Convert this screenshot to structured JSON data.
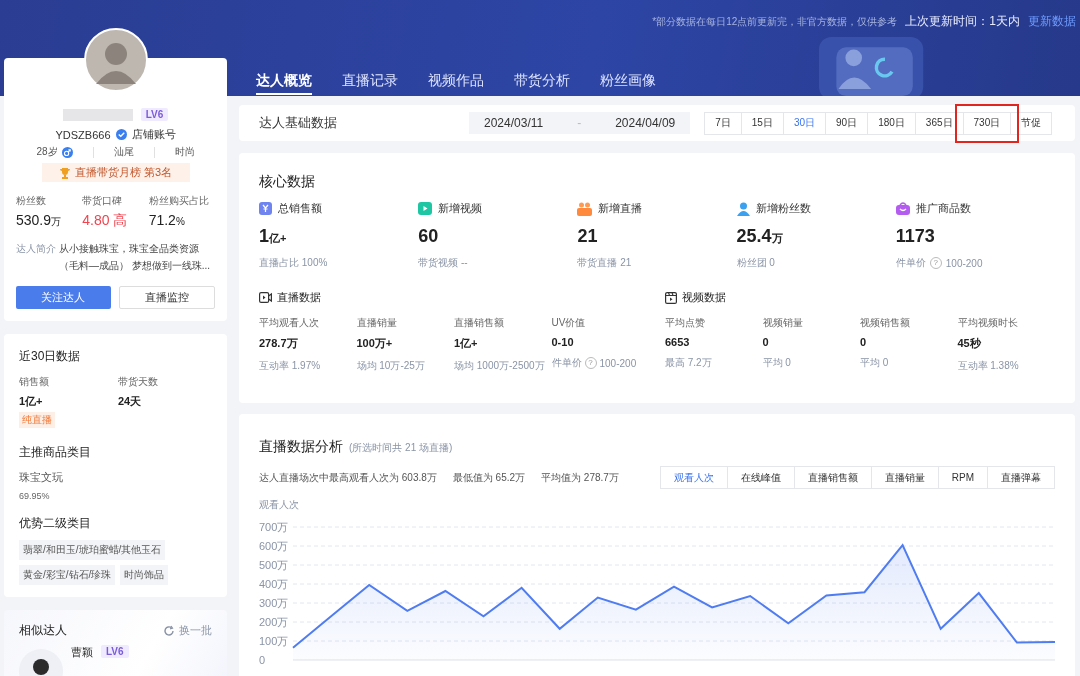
{
  "notice": {
    "text": "*部分数据在每日12点前更新完，非官方数据，仅供参考",
    "update_label": "上次更新时间：1天内",
    "update_link": "更新数据"
  },
  "profile": {
    "level": "LV6",
    "account": "YDSZB666",
    "account_type": "店铺账号",
    "age": "28岁",
    "region": "汕尾",
    "category": "时尚",
    "rank": "直播带货月榜 第3名",
    "stats": [
      {
        "label": "粉丝数",
        "value": "530.9",
        "unit": "万",
        "kind": "normal"
      },
      {
        "label": "带货口碑",
        "value": "4.80 高",
        "kind": "alert"
      },
      {
        "label": "粉丝购买占比",
        "value": "71.2",
        "unit": "%",
        "kind": "normal"
      }
    ],
    "intro_label": "达人简介",
    "intro": "从小接触珠宝，珠宝全品类资源（毛料—成品） 梦想做到一线珠...",
    "buttons": [
      {
        "label": "关注达人",
        "kind": "primary"
      },
      {
        "label": "直播监控",
        "kind": "secondary"
      }
    ]
  },
  "recent": {
    "title": "近30日数据",
    "stats": [
      {
        "label": "销售额",
        "value": "1亿+"
      },
      {
        "label": "带货天数",
        "value": "24天"
      }
    ],
    "tag": "纯直播",
    "main_title": "主推商品类目",
    "main_category": "珠宝文玩",
    "main_share": "69.95%",
    "sub_title": "优势二级类目",
    "sub_tags": [
      "翡翠/和田玉/琥珀蜜蜡/其他玉石",
      "黄金/彩宝/钻石/珍珠",
      "时尚饰品"
    ]
  },
  "similar": {
    "title": "相似达人",
    "refresh": "换一批",
    "items": [
      {
        "name": "曹颖",
        "level": "LV6"
      }
    ]
  },
  "tabs": [
    {
      "label": "达人概览",
      "selected": true
    },
    {
      "label": "直播记录",
      "selected": false
    },
    {
      "label": "视频作品",
      "selected": false
    },
    {
      "label": "带货分析",
      "selected": false
    },
    {
      "label": "粉丝画像",
      "selected": false
    }
  ],
  "filter": {
    "title": "达人基础数据",
    "start": "2024/03/11",
    "separator": "-",
    "end": "2024/04/09",
    "periods": [
      {
        "label": "7日",
        "selected": false,
        "annotated": false
      },
      {
        "label": "15日",
        "selected": false,
        "annotated": false
      },
      {
        "label": "30日",
        "selected": true,
        "annotated": false
      },
      {
        "label": "90日",
        "selected": false,
        "annotated": false
      },
      {
        "label": "180日",
        "selected": false,
        "annotated": false
      },
      {
        "label": "365日",
        "selected": false,
        "annotated": false
      },
      {
        "label": "730日",
        "selected": false,
        "annotated": true
      },
      {
        "label": "节促",
        "selected": false,
        "annotated": false
      }
    ]
  },
  "core": {
    "title": "核心数据",
    "metrics": [
      {
        "kind": "sales",
        "label": "总销售额",
        "value": "1",
        "unit": "亿+",
        "sub": "直播占比 100%"
      },
      {
        "kind": "video",
        "label": "新增视频",
        "value": "60",
        "sub": "带货视频 --"
      },
      {
        "kind": "live",
        "label": "新增直播",
        "value": "21",
        "sub": "带货直播 21"
      },
      {
        "kind": "fans",
        "label": "新增粉丝数",
        "value": "25.4",
        "unit": "万",
        "sub": "粉丝团 0"
      },
      {
        "kind": "goods",
        "label": "推广商品数",
        "value": "1173",
        "sub": "件单价",
        "help": "?",
        "sub_value": "100-200"
      }
    ],
    "groups": [
      {
        "kind": "live",
        "title": "直播数据",
        "items": [
          {
            "label": "平均观看人次",
            "value": "278.7万",
            "sub": "互动率 1.97%"
          },
          {
            "label": "直播销量",
            "value": "100万+",
            "sub": "场均 10万-25万"
          },
          {
            "label": "直播销售额",
            "value": "1亿+",
            "sub": "场均 1000万-2500万"
          },
          {
            "label": "UV价值",
            "value": "0-10",
            "sub": "件单价",
            "help": "?",
            "sub_value": "100-200"
          }
        ]
      },
      {
        "kind": "video",
        "title": "视频数据",
        "items": [
          {
            "label": "平均点赞",
            "value": "6653",
            "sub": "最高 7.2万"
          },
          {
            "label": "视频销量",
            "value": "0",
            "sub": "平均 0"
          },
          {
            "label": "视频销售额",
            "value": "0",
            "sub": "平均 0"
          },
          {
            "label": "平均视频时长",
            "value": "45秒",
            "sub": "互动率 1.38%"
          }
        ]
      }
    ]
  },
  "analysis": {
    "title": "直播数据分析",
    "note": "(所选时间共 21 场直播)",
    "summary": [
      "达人直播场次中最高观看人次为 603.8万",
      "最低值为 65.2万",
      "平均值为 278.7万"
    ],
    "metric_tabs": [
      {
        "label": "观看人次",
        "selected": true
      },
      {
        "label": "在线峰值",
        "selected": false
      },
      {
        "label": "直播销售额",
        "selected": false
      },
      {
        "label": "直播销量",
        "selected": false
      },
      {
        "label": "RPM",
        "selected": false
      },
      {
        "label": "直播弹幕",
        "selected": false
      }
    ],
    "chart_data": {
      "type": "area",
      "ylabel": "观看人次",
      "grid": true,
      "ylim": [
        0,
        700
      ],
      "yticks": [
        {
          "value": 0,
          "label": "0"
        },
        {
          "value": 100,
          "label": "100万"
        },
        {
          "value": 200,
          "label": "200万"
        },
        {
          "value": 300,
          "label": "300万"
        },
        {
          "value": 400,
          "label": "400万"
        },
        {
          "value": 500,
          "label": "500万"
        },
        {
          "value": 600,
          "label": "600万"
        },
        {
          "value": 700,
          "label": "700万"
        }
      ],
      "series": [
        {
          "color": "#4f7cf0",
          "values": [
            65,
            230,
            395,
            259,
            363,
            230,
            380,
            164,
            329,
            265,
            386,
            277,
            337,
            193,
            340,
            357,
            604,
            164,
            352,
            92,
            95
          ]
        }
      ]
    }
  }
}
